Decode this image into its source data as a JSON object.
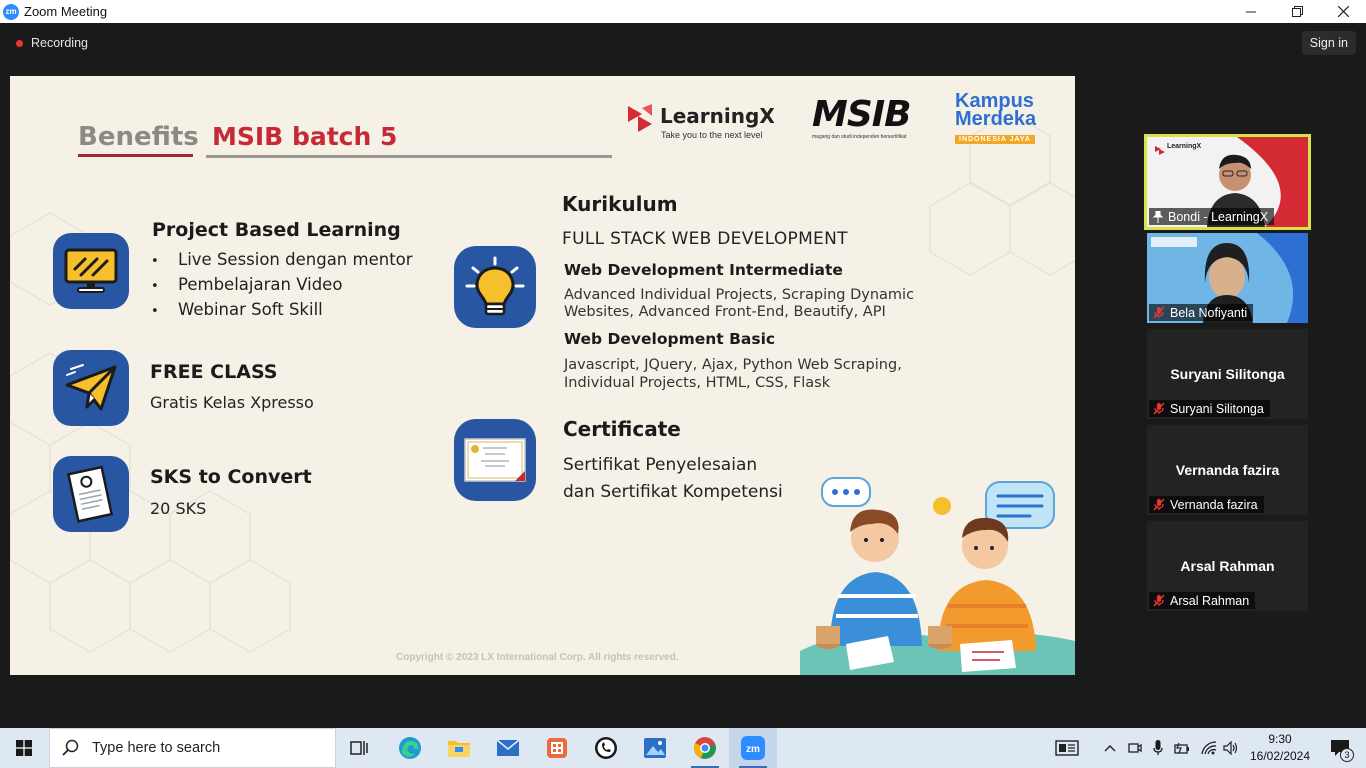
{
  "window": {
    "title": "Zoom Meeting",
    "zoom_logo_text": "zm"
  },
  "topbar": {
    "recording_label": "Recording",
    "signin_label": "Sign in"
  },
  "slide": {
    "tab_benefits": "Benefits",
    "tab_batch": "MSIB batch 5",
    "logos": {
      "learningx_name": "LearningX",
      "learningx_tagline": "Take you to the next level",
      "msib_name": "MSIB",
      "msib_tagline": "magang dan studi independen bersertifikat",
      "kampus_merdeka_name": "Kampus Merdeka",
      "kampus_merdeka_tagline": "INDONESIA JAYA"
    },
    "project_based": {
      "title": "Project Based Learning",
      "items": [
        "Live Session dengan mentor",
        "Pembelajaran Video",
        "Webinar Soft Skill"
      ]
    },
    "free_class": {
      "title": "FREE CLASS",
      "text": "Gratis Kelas Xpresso"
    },
    "sks": {
      "title": "SKS to Convert",
      "text": "20 SKS"
    },
    "kurikulum": {
      "title": "Kurikulum",
      "subtitle": "FULL STACK WEB DEVELOPMENT",
      "intermediate_title": "Web Development Intermediate",
      "intermediate_line1": "Advanced Individual Projects, Scraping Dynamic",
      "intermediate_line2": "Websites, Advanced Front-End, Beautify, API",
      "basic_title": "Web Development Basic",
      "basic_line1": "Javascript, JQuery, Ajax, Python Web Scraping,",
      "basic_line2": "Individual Projects, HTML, CSS, Flask"
    },
    "certificate": {
      "title": "Certificate",
      "line1": "Sertifikat Penyelesaian",
      "line2": "dan Sertifikat Kompetensi"
    },
    "copyright": "Copyright © 2023 LX International Corp. All rights reserved."
  },
  "participants": [
    {
      "name": "Bondi - LearningX",
      "video": true,
      "pinned": true,
      "active_speaker": true,
      "logo_text": "LearningX"
    },
    {
      "name": "Bela Nofiyanti",
      "video": true,
      "muted": true
    },
    {
      "name": "Suryani Silitonga",
      "video": false,
      "muted": true
    },
    {
      "name": "Vernanda fazira",
      "video": false,
      "muted": true
    },
    {
      "name": "Arsal Rahman",
      "video": false,
      "muted": true
    }
  ],
  "taskbar": {
    "search_placeholder": "Type here to search",
    "apps": [
      "task-view",
      "edge",
      "file-explorer",
      "mail",
      "office",
      "whatsapp",
      "photos",
      "chrome",
      "zoom"
    ],
    "clock_time": "9:30",
    "clock_date": "16/02/2024",
    "notifications_count": "3"
  },
  "colors": {
    "accent_red": "#c62a37",
    "brand_blue": "#2856a3",
    "active_speaker": "#d9e24a",
    "zoom_blue": "#2d8cff"
  }
}
